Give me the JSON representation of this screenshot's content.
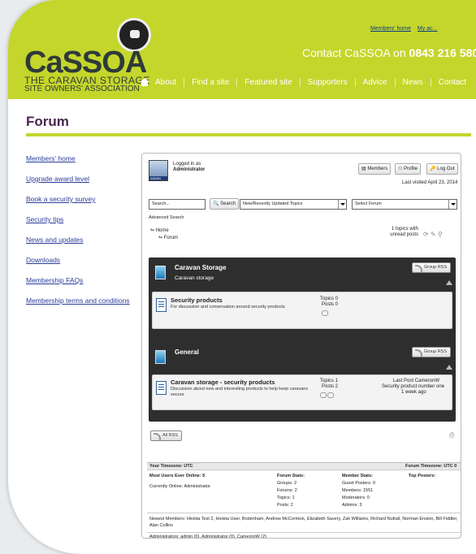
{
  "header": {
    "logo_text": "CaSSOA",
    "tagline_1": "THE CARAVAN STORAGE",
    "tagline_2": "SITE OWNERS' ASSOCIATION",
    "top_links": [
      "Members' home",
      "My ac..."
    ],
    "contact_label": "Contact CaSSOA on",
    "contact_phone": "0843 216 580",
    "nav": [
      "About",
      "Find a site",
      "Featured site",
      "Supporters",
      "Advice",
      "News",
      "Contact"
    ]
  },
  "page_title": "Forum",
  "sidebar": {
    "items": [
      "Members' home",
      "Upgrade award level",
      "Book a security survey",
      "Security tips",
      "News and updates",
      "Downloads",
      "Membership FAQs",
      "Membership terms and conditions"
    ]
  },
  "forum": {
    "logged_in_label": "Logged in as",
    "user": "Administrator",
    "avatar_label": "ADMIN",
    "buttons": {
      "members": "Members",
      "profile": "Profile",
      "logout": "Log Out"
    },
    "last_visited": "Last visited April 23, 2014",
    "search_placeholder": "Search...",
    "search_button": "Search",
    "topics_select": "New/Recently Updated Topics",
    "forum_select": "Select Forum",
    "advanced_search": "Advanced Search",
    "breadcrumb_home": "Home",
    "breadcrumb_forum": "Forum",
    "unread": "1 topics with unread posts",
    "group_rss": "Group RSS",
    "all_rss": "All RSS",
    "categories": [
      {
        "name": "Caravan Storage",
        "desc": "Caravan storage",
        "forum_title": "Security products",
        "forum_desc": "For discussion and conversation around security products",
        "topics": "Topics 0",
        "posts": "Posts 0",
        "last_post": "",
        "last_topic": "",
        "last_time": ""
      },
      {
        "name": "General",
        "desc": "",
        "forum_title": "Caravan storage - security products",
        "forum_desc": "Discussion about new and interesting products to help keep caravans secure",
        "topics": "Topics 1",
        "posts": "Posts 2",
        "last_post": "Last Post CameronW",
        "last_topic": "Security product number one",
        "last_time": "1 week ago"
      }
    ],
    "stats": {
      "your_timezone": "Your Timezone: UTC",
      "forum_timezone": "Forum Timezone: UTC 0",
      "most_users": "Most Users Ever Online: 5",
      "currently_online": "Currently Online: Administrator",
      "forum_stats_title": "Forum Stats:",
      "forum_stats": [
        "Groups: 2",
        "Forums: 2",
        "Topics: 1",
        "Posts: 2"
      ],
      "member_stats_title": "Member Stats:",
      "member_stats": [
        "Guest Posters: 0",
        "Members: 1551",
        "Moderators: 0",
        "Admins: 3"
      ],
      "top_posters": "Top Posters:",
      "newest_members": "Newest Members: Hivista Test 2, Hivista User, Bodenham, Andrew McCormick, Elizabeth Savery, Zak Williams, Richard Nuttall, Norman Enston, Bill Fiddler, Alan Collins",
      "administrators": "Administrators: admin (0), Administrator (0), CameronW (2)"
    }
  },
  "colors": {
    "brand_green": "#c4d62b",
    "title_purple": "#4a2650",
    "link_blue": "#2a3d9a",
    "category_bg": "#2e2e2e"
  }
}
